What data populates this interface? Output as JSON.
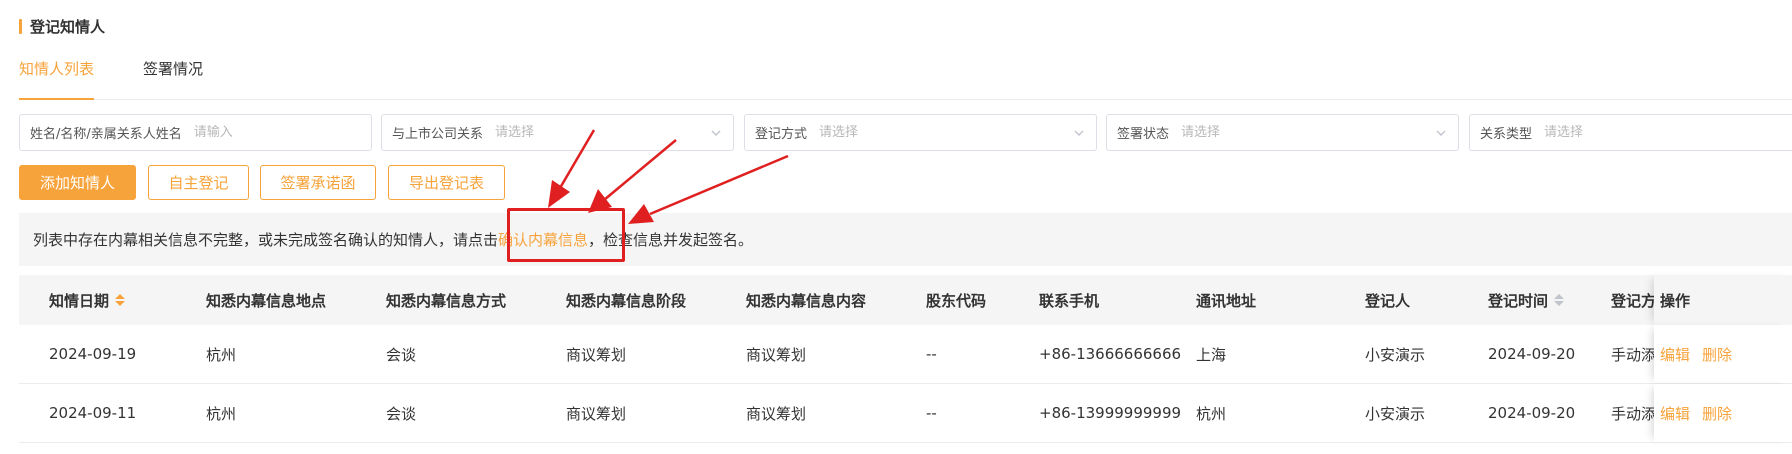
{
  "section_title": "登记知情人",
  "tabs": [
    {
      "label": "知情人列表",
      "active": true
    },
    {
      "label": "签署情况",
      "active": false
    }
  ],
  "filters": {
    "name": {
      "label": "姓名/名称/亲属关系人姓名",
      "placeholder": "请输入"
    },
    "relation": {
      "label": "与上市公司关系",
      "placeholder": "请选择"
    },
    "method": {
      "label": "登记方式",
      "placeholder": "请选择"
    },
    "sign_status": {
      "label": "签署状态",
      "placeholder": "请选择"
    },
    "relation_type": {
      "label": "关系类型",
      "placeholder": "请选择"
    }
  },
  "buttons": {
    "add": "添加知情人",
    "self_register": "自主登记",
    "sign_commitment": "签署承诺函",
    "export": "导出登记表"
  },
  "notice": {
    "prefix": "列表中存在内幕相关信息不完整，或未完成签名确认的知情人，请点击",
    "link": "确认内幕信息",
    "suffix": "，检查信息并发起签名。"
  },
  "table": {
    "headers": {
      "date": "知情日期",
      "location": "知悉内幕信息地点",
      "method": "知悉内幕信息方式",
      "stage": "知悉内幕信息阶段",
      "content": "知悉内幕信息内容",
      "stock": "股东代码",
      "phone": "联系手机",
      "address": "通讯地址",
      "registrant": "登记人",
      "reg_time": "登记时间",
      "reg_method": "登记方式",
      "ops": "操作"
    },
    "rows": [
      {
        "date": "2024-09-19",
        "location": "杭州",
        "method": "会谈",
        "stage": "商议筹划",
        "content": "商议筹划",
        "stock": "--",
        "phone": "+86-13666666666",
        "address": "上海",
        "registrant": "小安演示",
        "reg_time": "2024-09-20",
        "reg_method": "手动添加"
      },
      {
        "date": "2024-09-11",
        "location": "杭州",
        "method": "会谈",
        "stage": "商议筹划",
        "content": "商议筹划",
        "stock": "--",
        "phone": "+86-13999999999",
        "address": "杭州",
        "registrant": "小安演示",
        "reg_time": "2024-09-20",
        "reg_method": "手动添加"
      }
    ],
    "row_actions": {
      "edit": "编辑",
      "delete": "删除"
    }
  },
  "colors": {
    "accent": "#f7a33b",
    "annotation": "#e02020"
  }
}
